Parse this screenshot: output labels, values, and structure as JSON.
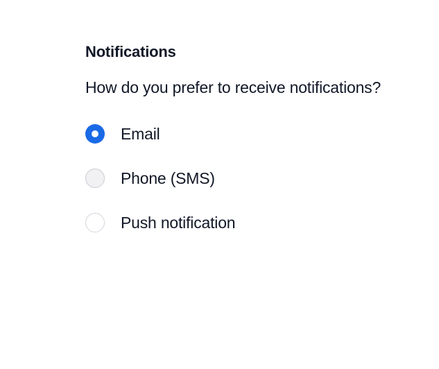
{
  "section": {
    "title": "Notifications",
    "description": "How do you prefer to receive notifications?"
  },
  "options": [
    {
      "label": "Email",
      "checked": true
    },
    {
      "label": "Phone (SMS)",
      "checked": false
    },
    {
      "label": "Push notification",
      "checked": false
    }
  ],
  "colors": {
    "accent": "#1a6ae6",
    "text": "#111827",
    "radio_border": "#d1d5db",
    "radio_hover_bg": "#f1f1f3"
  },
  "icons": {
    "selected": "radio-checked-icon",
    "unselected": "radio-unchecked-icon"
  }
}
